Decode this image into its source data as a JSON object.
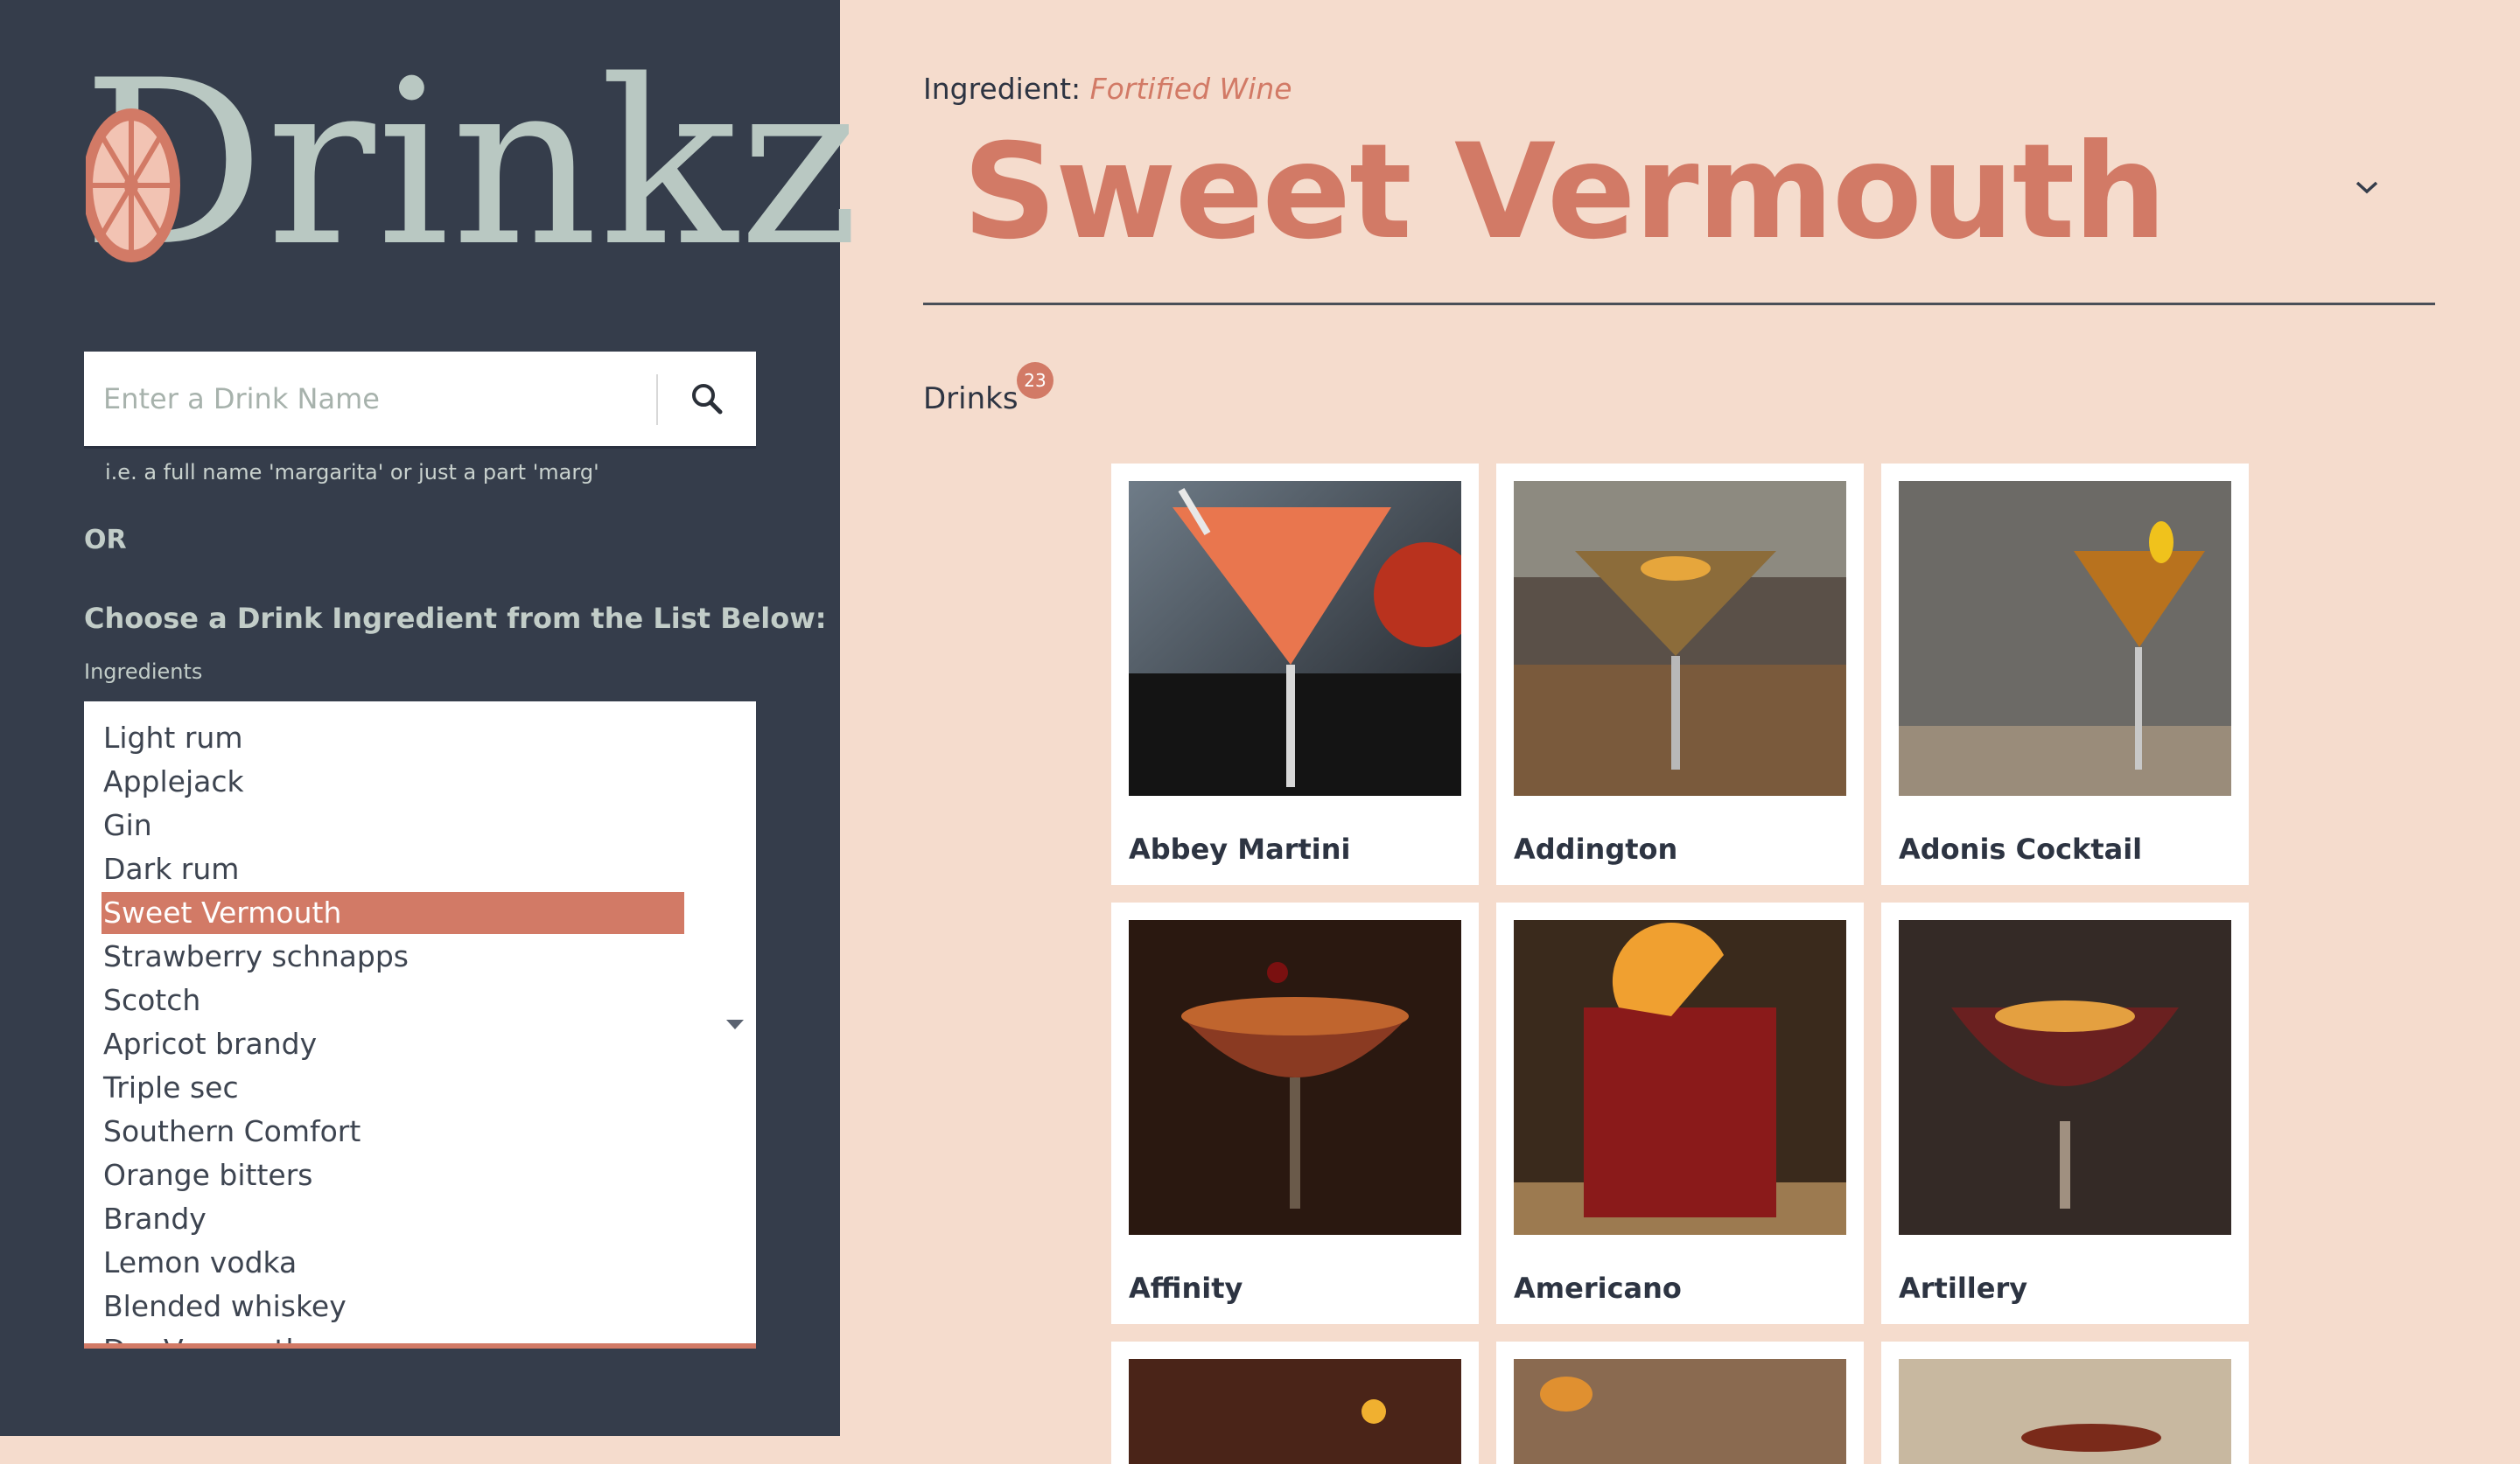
{
  "brand": {
    "logo_text": "Drinkz"
  },
  "search": {
    "placeholder": "Enter a Drink Name",
    "hint": "i.e. a full name 'margarita' or just a part 'marg'"
  },
  "sidebar": {
    "or_text": "OR",
    "choose_text": "Choose a Drink Ingredient from the List Below:",
    "ingredients_label": "Ingredients",
    "ingredients": [
      "Light rum",
      "Applejack",
      "Gin",
      "Dark rum",
      "Sweet Vermouth",
      "Strawberry schnapps",
      "Scotch",
      "Apricot brandy",
      "Triple sec",
      "Southern Comfort",
      "Orange bitters",
      "Brandy",
      "Lemon vodka",
      "Blended whiskey",
      "Dry Vermouth"
    ],
    "selected_ingredient": "Sweet Vermouth"
  },
  "main": {
    "ingredient_prefix": "Ingredient: ",
    "ingredient_type": "Fortified Wine",
    "title": "Sweet Vermouth",
    "drinks_label": "Drinks",
    "drinks_count": "23",
    "drinks": [
      {
        "name": "Abbey Martini"
      },
      {
        "name": "Addington"
      },
      {
        "name": "Adonis Cocktail"
      },
      {
        "name": "Affinity"
      },
      {
        "name": "Americano"
      },
      {
        "name": "Artillery"
      }
    ]
  },
  "colors": {
    "sidebar_bg": "#353d4b",
    "main_bg": "#f5dccd",
    "accent": "#d27a66",
    "logo": "#b9c8c2"
  },
  "icons": {
    "search": "search-icon",
    "chevron": "chevron-down-icon",
    "logo_mark": "grapefruit-slice-icon"
  }
}
